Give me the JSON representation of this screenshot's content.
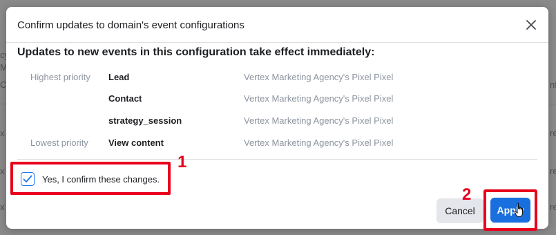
{
  "background": {
    "fragments": [
      "cy",
      "M",
      "Cu",
      "x",
      "x",
      "x",
      "nfi",
      "re",
      "re",
      "re",
      "re",
      "ge"
    ]
  },
  "modal": {
    "title": "Confirm updates to domain's event configurations",
    "subheading": "Updates to new events in this configuration take effect immediately:",
    "close_icon": "close-icon",
    "events": [
      {
        "priority": "Highest priority",
        "name": "Lead",
        "pixel": "Vertex Marketing Agency's Pixel Pixel"
      },
      {
        "priority": "",
        "name": "Contact",
        "pixel": "Vertex Marketing Agency's Pixel Pixel"
      },
      {
        "priority": "",
        "name": "strategy_session",
        "pixel": "Vertex Marketing Agency's Pixel Pixel"
      },
      {
        "priority": "Lowest priority",
        "name": "View content",
        "pixel": "Vertex Marketing Agency's Pixel Pixel"
      }
    ],
    "confirm_label": "Yes, I confirm these changes.",
    "confirm_checked": true,
    "cancel_label": "Cancel",
    "apply_label": "Apply"
  },
  "annotations": {
    "step1": "1",
    "step2": "2",
    "highlight_color": "#e8001c"
  },
  "colors": {
    "accent": "#1a6fde",
    "checkbox": "#1877f2"
  }
}
